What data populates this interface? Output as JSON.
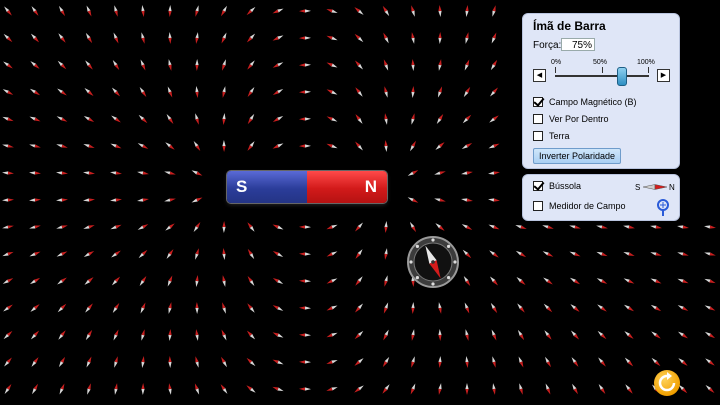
{
  "magnet": {
    "south_label": "S",
    "north_label": "N",
    "south_color": "#2b3d9a",
    "north_color": "#d21a1a"
  },
  "panel": {
    "title": "Ímã de Barra",
    "strength_label": "Força:",
    "strength_value": "75%",
    "slider": {
      "min_label": "0%",
      "mid_label": "50%",
      "max_label": "100%",
      "value_percent": 75,
      "left_icon": "triangle-left-icon",
      "right_icon": "triangle-right-icon"
    },
    "options": [
      {
        "label": "Campo Magnético (B)",
        "checked": true
      },
      {
        "label": "Ver Por Dentro",
        "checked": false
      },
      {
        "label": "Terra",
        "checked": false
      }
    ],
    "invert_button": "Inverter Polaridade"
  },
  "tools": {
    "compass": {
      "label": "Bússola",
      "checked": true,
      "legend_s": "S",
      "legend_n": "N"
    },
    "field_meter": {
      "label": "Medidor de Campo",
      "checked": false,
      "icon": "probe-icon"
    }
  },
  "reset_icon": "reset-icon",
  "colors": {
    "panel_bg": "#dfe6f7",
    "button_bg": "#a9cff3",
    "reset": "#f0a000",
    "arrow_north": "#c81e1e"
  }
}
